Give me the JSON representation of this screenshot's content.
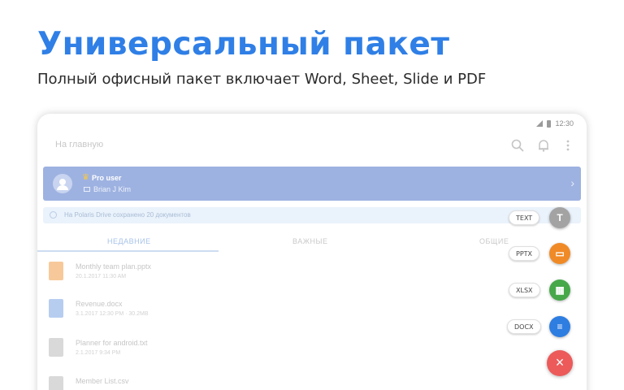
{
  "promo": {
    "headline": "Универсальный пакет",
    "subhead": "Полный офисный пакет включает Word, Sheet, Slide и PDF"
  },
  "status_bar": {
    "time": "12:30"
  },
  "app_bar": {
    "title": "На главную",
    "icons": [
      "search-icon",
      "bell-icon",
      "more-icon"
    ]
  },
  "pro_card": {
    "title": "Pro user",
    "name": "Brian J Kim"
  },
  "notice": {
    "text": "На Polaris Drive сохранено 20 документов"
  },
  "tabs": [
    {
      "label": "НЕДАВНИЕ",
      "active": true
    },
    {
      "label": "ВАЖНЫЕ",
      "active": false
    },
    {
      "label": "ОБЩИЕ",
      "active": false
    }
  ],
  "files": [
    {
      "name": "Monthly team plan.pptx",
      "meta": "20.1.2017 11:30 AM",
      "color": "#f7c99a"
    },
    {
      "name": "Revenue.docx",
      "meta": "3.1.2017 12:30 PM · 30.2MB",
      "color": "#b7cdf0"
    },
    {
      "name": "Planner for android.txt",
      "meta": "2.1.2017 9:34 PM",
      "color": "#d9d9d9"
    },
    {
      "name": "Member List.csv",
      "meta": "",
      "color": "#d9d9d9"
    }
  ],
  "fab_menu": [
    {
      "label": "TEXT",
      "icon": "text-icon",
      "color": "#a3a3a3",
      "glyph": "T"
    },
    {
      "label": "PPTX",
      "icon": "slides-icon",
      "color": "#f08a26",
      "glyph": "▭"
    },
    {
      "label": "XLSX",
      "icon": "sheet-icon",
      "color": "#47a84a",
      "glyph": "▦"
    },
    {
      "label": "DOCX",
      "icon": "doc-icon",
      "color": "#2e7de1",
      "glyph": "≡"
    }
  ],
  "close_glyph": "×"
}
